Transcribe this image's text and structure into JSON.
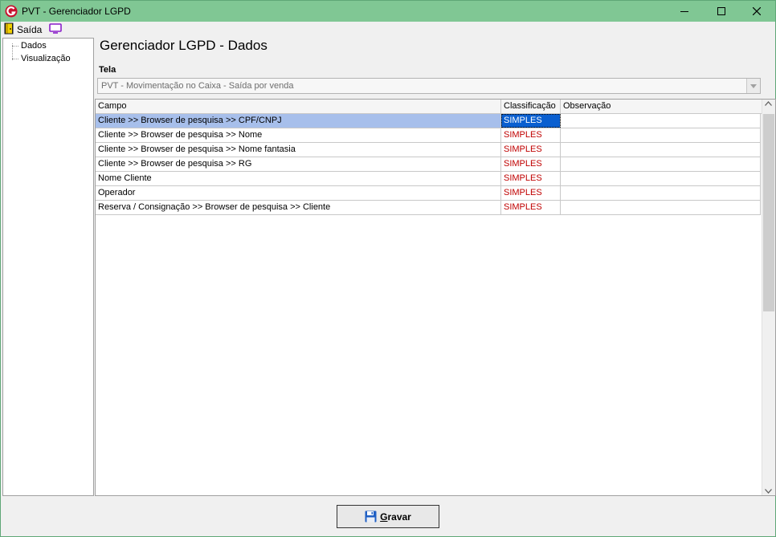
{
  "window": {
    "title": "PVT - Gerenciador LGPD"
  },
  "menu": {
    "exit_label": "Saída",
    "exit_icon": "door-exit-icon",
    "screen_icon": "monitor-icon"
  },
  "tree": {
    "items": [
      {
        "label": "Dados"
      },
      {
        "label": "Visualização"
      }
    ]
  },
  "page": {
    "title": "Gerenciador LGPD - Dados"
  },
  "screen_select": {
    "label": "Tela",
    "value": "PVT - Movimentação no Caixa - Saída por venda"
  },
  "grid": {
    "columns": [
      "Campo",
      "Classificação",
      "Observação"
    ],
    "rows": [
      {
        "campo": "Cliente >> Browser de pesquisa >> CPF/CNPJ",
        "classificacao": "SIMPLES",
        "observacao": ""
      },
      {
        "campo": "Cliente >> Browser de pesquisa >> Nome",
        "classificacao": "SIMPLES",
        "observacao": ""
      },
      {
        "campo": "Cliente >> Browser de pesquisa >> Nome fantasia",
        "classificacao": "SIMPLES",
        "observacao": ""
      },
      {
        "campo": "Cliente >> Browser de pesquisa >> RG",
        "classificacao": "SIMPLES",
        "observacao": ""
      },
      {
        "campo": "Nome Cliente",
        "classificacao": "SIMPLES",
        "observacao": ""
      },
      {
        "campo": "Operador",
        "classificacao": "SIMPLES",
        "observacao": ""
      },
      {
        "campo": "Reserva / Consignação >> Browser de pesquisa >> Cliente",
        "classificacao": "SIMPLES",
        "observacao": ""
      }
    ],
    "selected_row": 0
  },
  "footer": {
    "save_accel": "G",
    "save_rest": "ravar",
    "save_icon": "floppy-disk-icon"
  },
  "colors": {
    "titlebar": "#80c794",
    "selection": "#a7bfeb",
    "selection_focus": "#0a5fd0",
    "classification_text": "#c00000"
  }
}
